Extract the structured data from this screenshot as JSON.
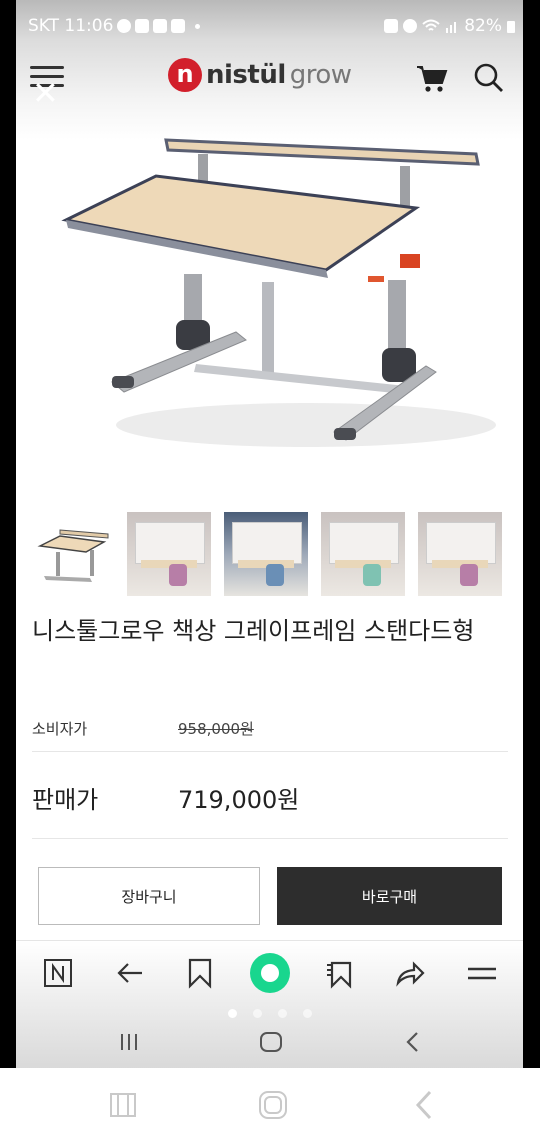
{
  "status_bar": {
    "carrier_time": "SKT 11:06",
    "battery": "82%"
  },
  "header": {
    "logo_mark": "n",
    "logo_text_bold": "nistül",
    "logo_text_light": "grow"
  },
  "product": {
    "title": "니스툴그로우 책상 그레이프레임 스탠다드형",
    "consumer_price_label": "소비자가",
    "consumer_price": "958,000원",
    "sale_price_label": "판매가",
    "sale_price": "719,000원"
  },
  "actions": {
    "cart_label": "장바구니",
    "buy_label": "바로구매"
  },
  "bottom_bar": {
    "icons": [
      "naver-home-icon",
      "back-arrow-icon",
      "bookmark-icon",
      "green-circle-icon",
      "bookmark-add-icon",
      "share-icon",
      "menu-icon"
    ],
    "page_count": 4,
    "active_page": 1
  }
}
